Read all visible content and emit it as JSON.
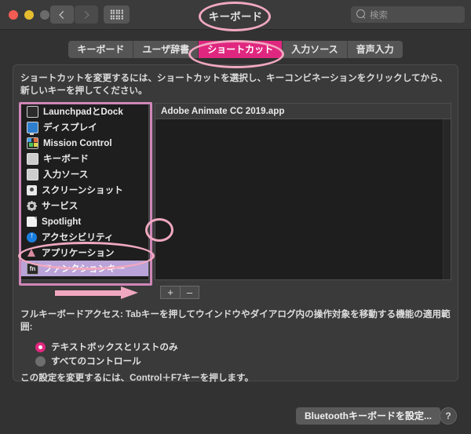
{
  "window": {
    "title": "キーボード",
    "traffic_lights": [
      "close",
      "minimize",
      "zoom"
    ]
  },
  "toolbar": {
    "back_label": "‹",
    "forward_label": "›",
    "grid_label": "すべてを表示",
    "search": {
      "placeholder": "検索",
      "value": "",
      "icon": "search-icon"
    }
  },
  "tabs": [
    {
      "label": "キーボード",
      "selected": false
    },
    {
      "label": "ユーザ辞書",
      "selected": false
    },
    {
      "label": "ショートカット",
      "selected": true
    },
    {
      "label": "入力ソース",
      "selected": false
    },
    {
      "label": "音声入力",
      "selected": false
    }
  ],
  "panel": {
    "instruction": "ショートカットを変更するには、ショートカットを選択し、キーコンビネーションをクリックしてから、新しいキーを押してください。",
    "sidebar": {
      "items": [
        {
          "label": "LaunchpadとDock",
          "icon": "launchpad-icon",
          "selected": false
        },
        {
          "label": "ディスプレイ",
          "icon": "display-icon",
          "selected": false
        },
        {
          "label": "Mission Control",
          "icon": "mission-control-icon",
          "selected": false
        },
        {
          "label": "キーボード",
          "icon": "keyboard-icon",
          "selected": false
        },
        {
          "label": "入力ソース",
          "icon": "input-source-icon",
          "selected": false
        },
        {
          "label": "スクリーンショット",
          "icon": "screenshot-icon",
          "selected": false
        },
        {
          "label": "サービス",
          "icon": "services-icon",
          "selected": false
        },
        {
          "label": "Spotlight",
          "icon": "spotlight-icon",
          "selected": false
        },
        {
          "label": "アクセシビリティ",
          "icon": "accessibility-icon",
          "selected": false
        },
        {
          "label": "アプリケーション",
          "icon": "applications-icon",
          "selected": false
        },
        {
          "label": "ファンクションキー",
          "icon": "fn-key-icon",
          "selected": true
        }
      ]
    },
    "shortcut_list": {
      "rows": [
        {
          "label": "Adobe Animate CC 2019.app",
          "header": true
        }
      ]
    },
    "add_button": "+",
    "remove_button": "–",
    "full_keyboard_access_text": "フルキーボードアクセス: Tabキーを押してウインドウやダイアログ内の操作対象を移動する機能の適用範囲:",
    "radios": [
      {
        "label": "テキストボックスとリストのみ",
        "selected": true
      },
      {
        "label": "すべてのコントロール",
        "selected": false
      }
    ],
    "hint": "この設定を変更するには、Control＋F7キーを押します。"
  },
  "footer": {
    "bluetooth_button": "Bluetoothキーボードを設定...",
    "help_button": "?"
  },
  "annotations": {
    "color": "#f0a8c0",
    "rect_color": "#cf87b8",
    "marks": [
      {
        "type": "ellipse",
        "target": "window-title"
      },
      {
        "type": "ellipse",
        "target": "tab-shortcuts"
      },
      {
        "type": "rect",
        "target": "sidebar-list"
      },
      {
        "type": "ellipse",
        "target": "sidebar-item-function-keys"
      },
      {
        "type": "ellipse",
        "target": "add-shortcut-button"
      },
      {
        "type": "arrow",
        "target": "add-shortcut-button"
      }
    ]
  },
  "colors": {
    "accent_pink": "#e0277f",
    "annotation_pink": "#f0a8c0",
    "selected_row": "#b9a3d8",
    "panel_bg": "#3a3a3a",
    "list_bg": "#1e1e1e"
  }
}
